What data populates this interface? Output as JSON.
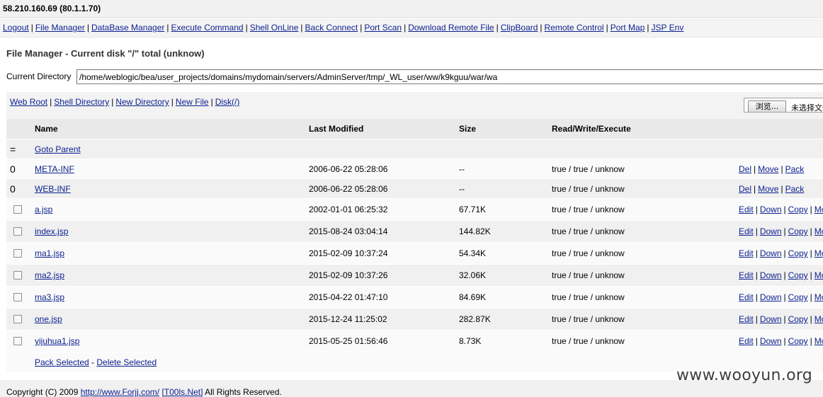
{
  "host": "58.210.160.69 (80.1.1.70)",
  "nav": [
    "Logout",
    "File Manager",
    "DataBase Manager",
    "Execute Command",
    "Shell OnLine",
    "Back Connect",
    "Port Scan",
    "Download Remote File",
    "ClipBoard",
    "Remote Control",
    "Port Map",
    "JSP Env"
  ],
  "title": "File Manager - Current disk \"/\" total (unknow)",
  "current_dir": {
    "label": "Current Directory",
    "value": "/home/weblogic/bea/user_projects/domains/mydomain/servers/AdminServer/tmp/_WL_user/ww/k9kguu/war/wa"
  },
  "tools": [
    "Web Root",
    "Shell Directory",
    "New Directory",
    "New File",
    "Disk(/)"
  ],
  "upload": {
    "browse": "浏览...",
    "no_file": "未选择文件。"
  },
  "table": {
    "headers": {
      "name": "Name",
      "modified": "Last Modified",
      "size": "Size",
      "rwx": "Read/Write/Execute"
    },
    "parent": {
      "glyph": "=",
      "label": "Goto Parent"
    },
    "dirs": [
      {
        "glyph": "0",
        "name": "META-INF",
        "modified": "2006-06-22 05:28:06",
        "size": "--",
        "rwx": "true / true / unknow",
        "actions": [
          "Del",
          "Move",
          "Pack"
        ]
      },
      {
        "glyph": "0",
        "name": "WEB-INF",
        "modified": "2006-06-22 05:28:06",
        "size": "--",
        "rwx": "true / true / unknow",
        "actions": [
          "Del",
          "Move",
          "Pack"
        ]
      }
    ],
    "files": [
      {
        "name": "a.jsp",
        "modified": "2002-01-01 06:25:32",
        "size": "67.71K",
        "rwx": "true / true / unknow",
        "actions": [
          "Edit",
          "Down",
          "Copy",
          "Mo"
        ]
      },
      {
        "name": "index.jsp",
        "modified": "2015-08-24 03:04:14",
        "size": "144.82K",
        "rwx": "true / true / unknow",
        "actions": [
          "Edit",
          "Down",
          "Copy",
          "Mo"
        ]
      },
      {
        "name": "ma1.jsp",
        "modified": "2015-02-09 10:37:24",
        "size": "54.34K",
        "rwx": "true / true / unknow",
        "actions": [
          "Edit",
          "Down",
          "Copy",
          "Mo"
        ]
      },
      {
        "name": "ma2.jsp",
        "modified": "2015-02-09 10:37:26",
        "size": "32.06K",
        "rwx": "true / true / unknow",
        "actions": [
          "Edit",
          "Down",
          "Copy",
          "Mo"
        ]
      },
      {
        "name": "ma3.jsp",
        "modified": "2015-04-22 01:47:10",
        "size": "84.69K",
        "rwx": "true / true / unknow",
        "actions": [
          "Edit",
          "Down",
          "Copy",
          "Mo"
        ]
      },
      {
        "name": "one.jsp",
        "modified": "2015-12-24 11:25:02",
        "size": "282.87K",
        "rwx": "true / true / unknow",
        "actions": [
          "Edit",
          "Down",
          "Copy",
          "Mo"
        ]
      },
      {
        "name": "yijuhua1.jsp",
        "modified": "2015-05-25 01:56:46",
        "size": "8.73K",
        "rwx": "true / true / unknow",
        "actions": [
          "Edit",
          "Down",
          "Copy",
          "Mo"
        ]
      }
    ],
    "bulk": [
      "Pack Selected",
      "Delete Selected"
    ]
  },
  "copyright": {
    "prefix": "Copyright (C) 2009",
    "link1": "http://www.Forjj.com/",
    "link2": "[T00ls.Net]",
    "suffix": "All Rights Reserved."
  },
  "watermark": "www.wooyun.org",
  "colors": {
    "link": "#0b1f8f",
    "row_odd": "#f0f0f0",
    "row_even": "#fafafa",
    "header": "#e9e9e9"
  }
}
